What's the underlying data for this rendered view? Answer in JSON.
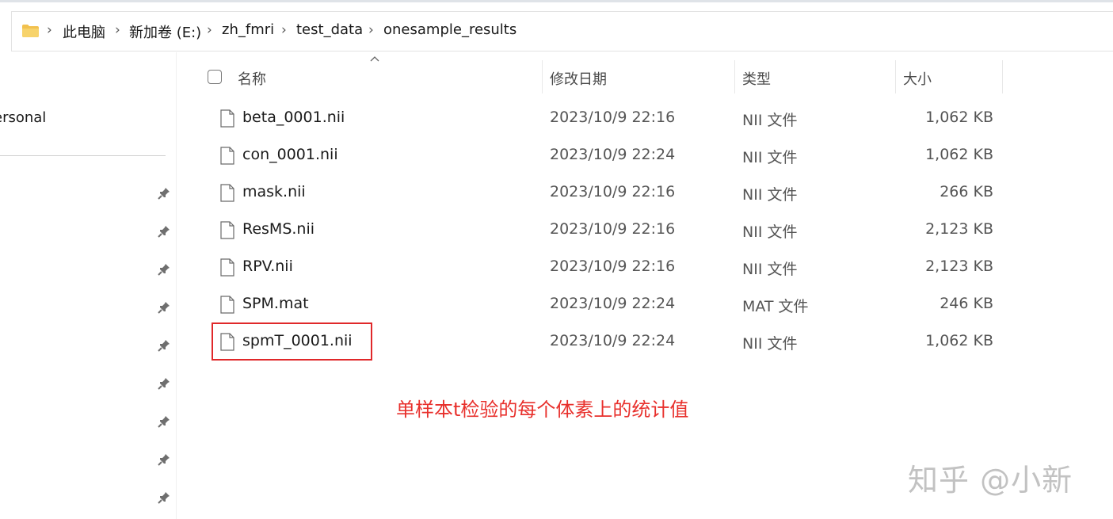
{
  "breadcrumb": {
    "items": [
      "此电脑",
      "新加卷 (E:)",
      "zh_fmri",
      "test_data",
      "onesample_results"
    ],
    "separator": "›"
  },
  "nav": {
    "partial_label": "ersonal"
  },
  "columns": {
    "name": "名称",
    "date": "修改日期",
    "type": "类型",
    "size": "大小"
  },
  "files": [
    {
      "name": "beta_0001.nii",
      "date": "2023/10/9 22:16",
      "type": "NII 文件",
      "size": "1,062 KB"
    },
    {
      "name": "con_0001.nii",
      "date": "2023/10/9 22:24",
      "type": "NII 文件",
      "size": "1,062 KB"
    },
    {
      "name": "mask.nii",
      "date": "2023/10/9 22:16",
      "type": "NII 文件",
      "size": "266 KB"
    },
    {
      "name": "ResMS.nii",
      "date": "2023/10/9 22:16",
      "type": "NII 文件",
      "size": "2,123 KB"
    },
    {
      "name": "RPV.nii",
      "date": "2023/10/9 22:16",
      "type": "NII 文件",
      "size": "2,123 KB"
    },
    {
      "name": "SPM.mat",
      "date": "2023/10/9 22:24",
      "type": "MAT 文件",
      "size": "246 KB"
    },
    {
      "name": "spmT_0001.nii",
      "date": "2023/10/9 22:24",
      "type": "NII 文件",
      "size": "1,062 KB"
    }
  ],
  "annotation": {
    "text": "单样本t检验的每个体素上的统计值",
    "color": "#e8302c"
  },
  "watermark": "知乎 @小新",
  "colors": {
    "folder": "#f2c14e",
    "highlight": "#e0282a"
  }
}
